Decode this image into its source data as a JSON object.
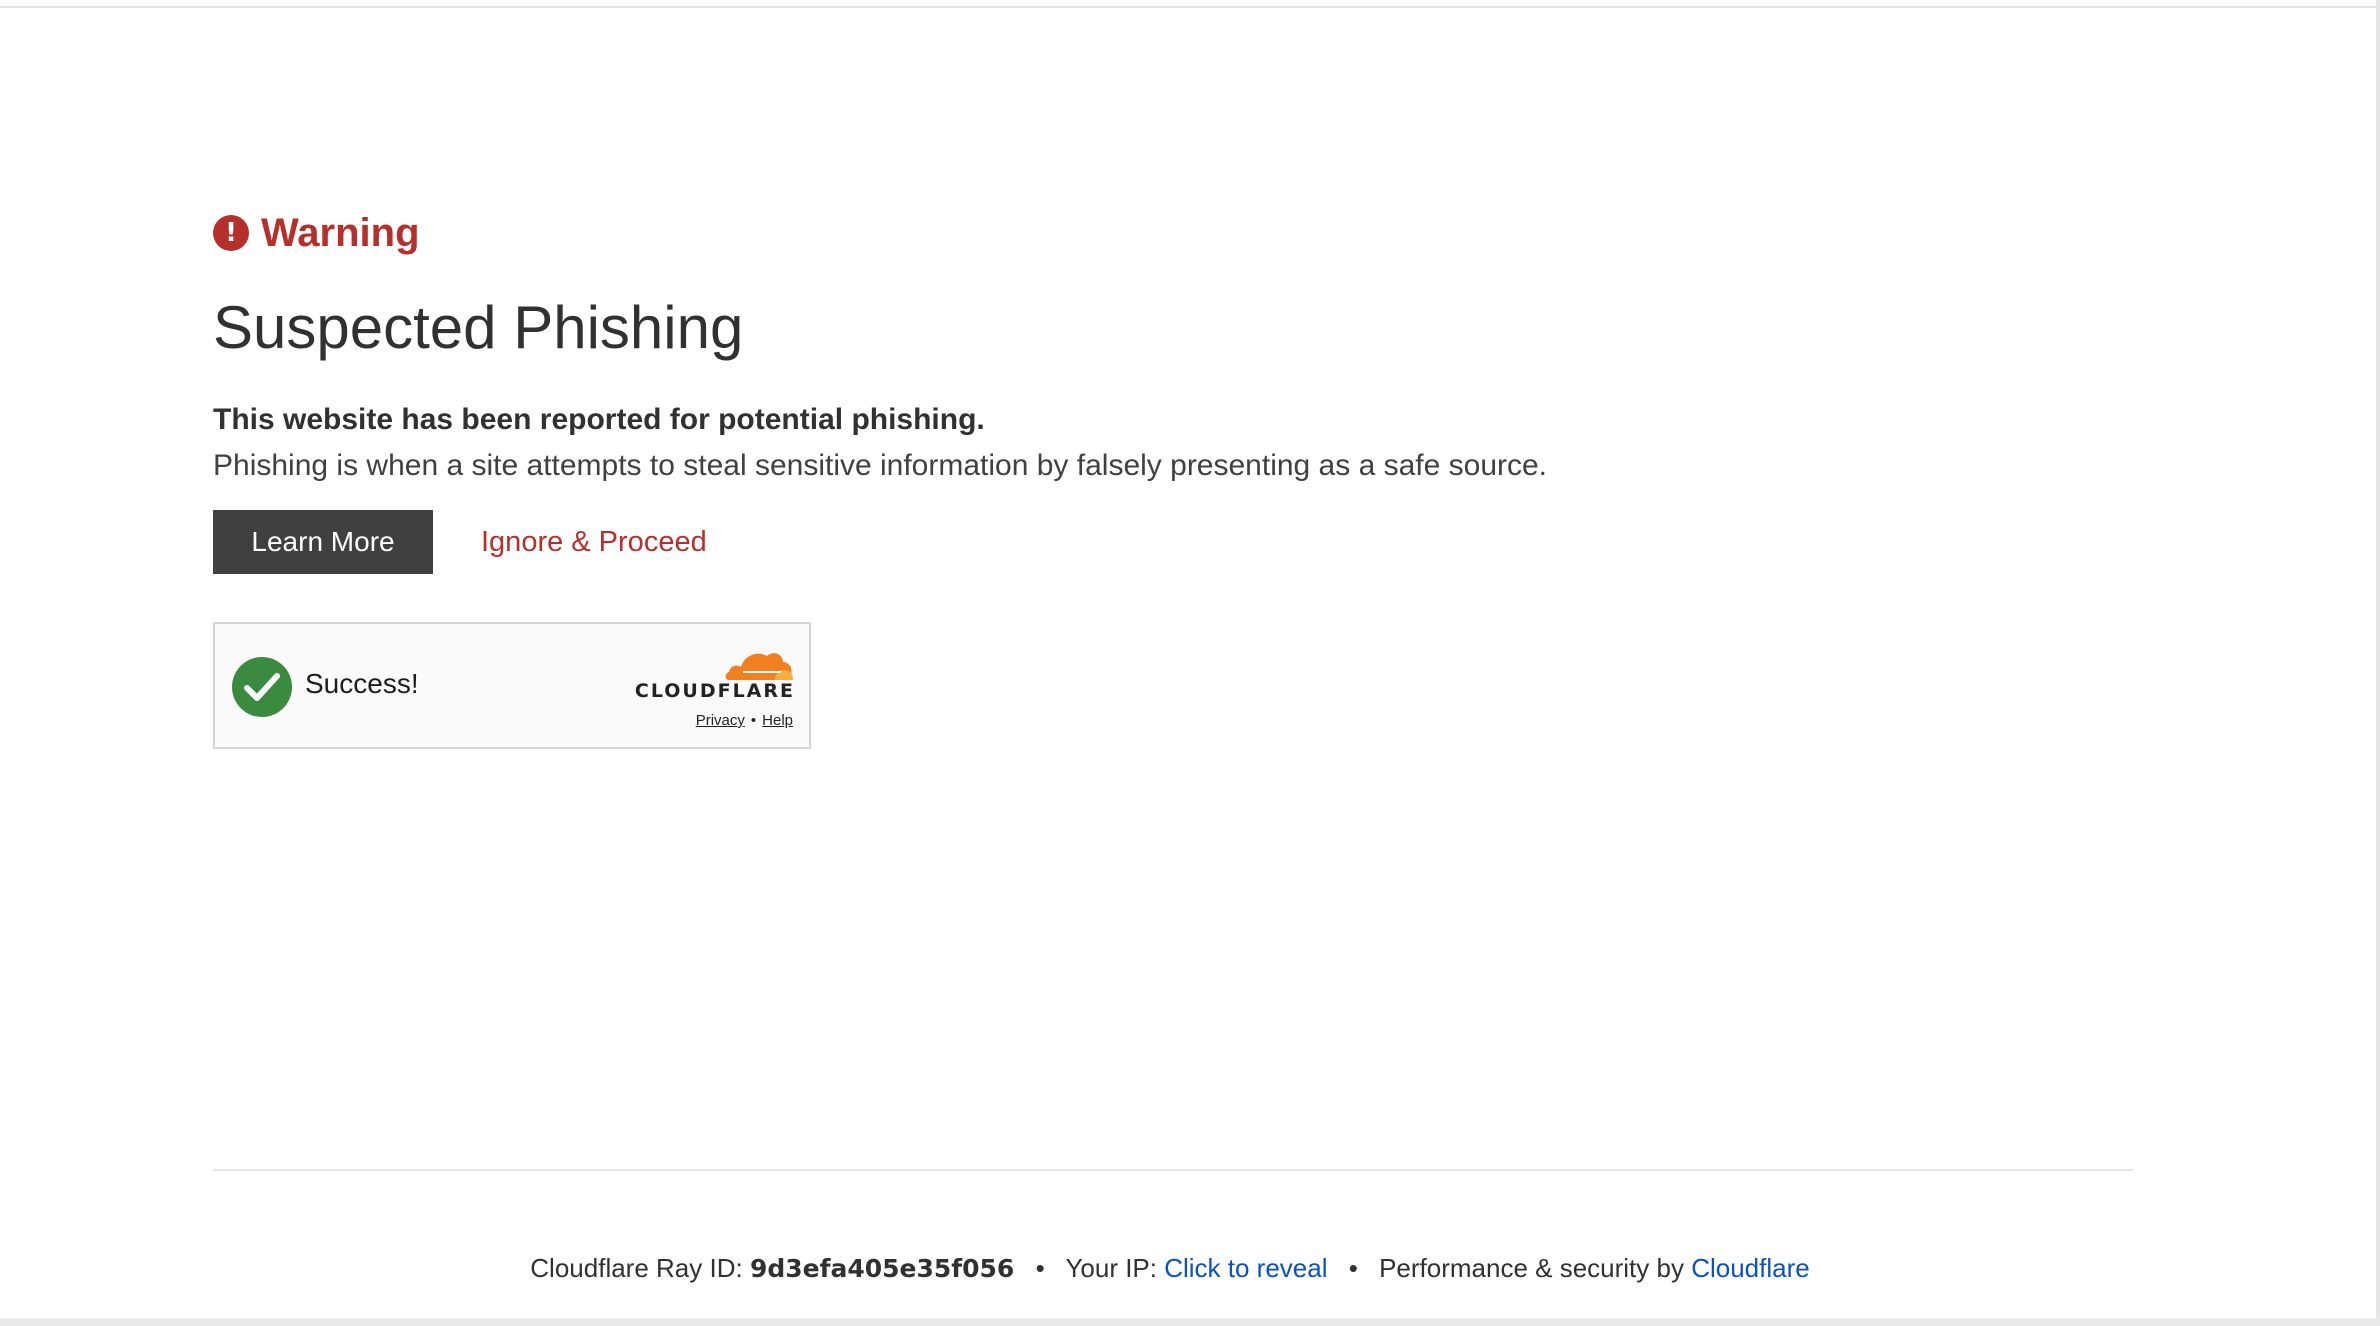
{
  "warning": {
    "icon": "exclamation-circle-icon",
    "icon_glyph": "!",
    "label": "Warning",
    "color": "#b5302b"
  },
  "page": {
    "title": "Suspected Phishing",
    "lead": "This website has been reported for potential phishing.",
    "description": "Phishing is when a site attempts to steal sensitive information by falsely presenting as a safe source."
  },
  "actions": {
    "learn_more_label": "Learn More",
    "ignore_label": "Ignore & Proceed"
  },
  "turnstile": {
    "status_text": "Success!",
    "status_icon": "checkmark-circle-icon",
    "brand": "CLOUDFLARE",
    "brand_icon": "cloudflare-cloud-icon",
    "privacy_label": "Privacy",
    "separator": "•",
    "help_label": "Help"
  },
  "footer": {
    "ray_label": "Cloudflare Ray ID:",
    "ray_id": "9d3efa405e35f056",
    "separator": "•",
    "ip_label": "Your IP:",
    "ip_link": "Click to reveal",
    "perf_label": "Performance & security by",
    "perf_link": "Cloudflare",
    "link_color": "#0a51c2"
  }
}
